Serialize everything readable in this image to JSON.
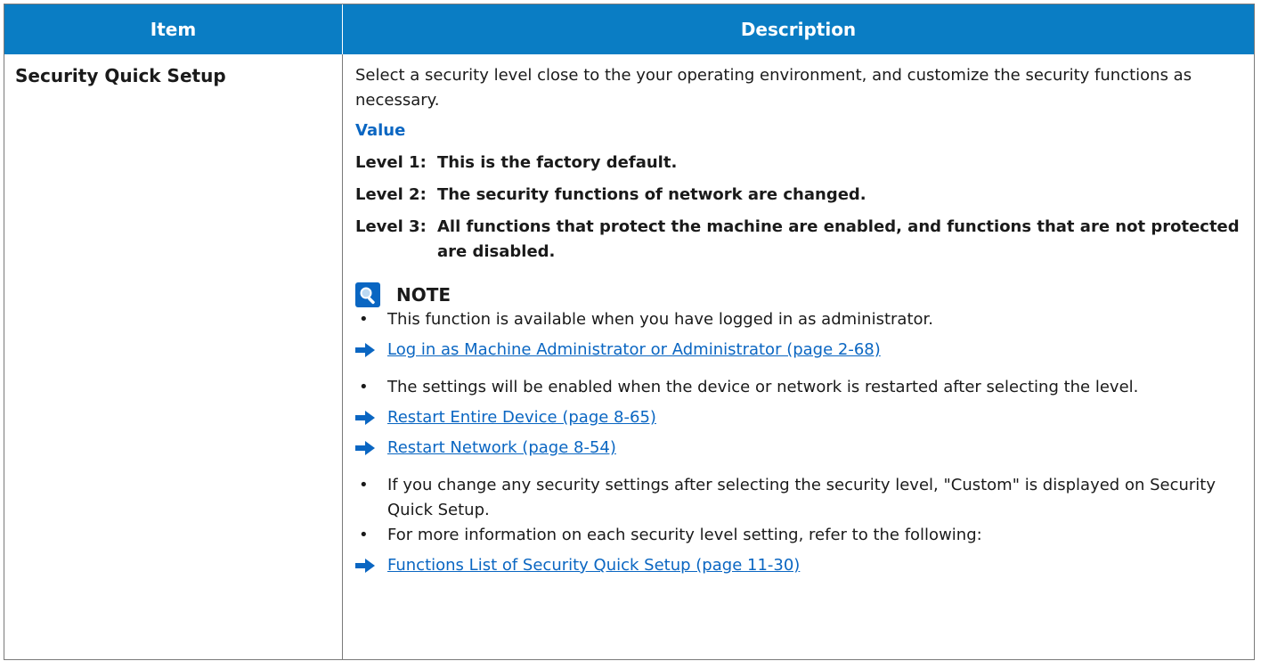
{
  "table": {
    "headers": [
      "Item",
      "Description"
    ],
    "item": "Security Quick Setup",
    "intro": "Select a security level close to the your operating environment, and customize the security functions as necessary.",
    "value_label": "Value",
    "levels": [
      {
        "key": "Level 1:",
        "text": "This is the factory default."
      },
      {
        "key": "Level 2:",
        "text": "The security functions of network are changed."
      },
      {
        "key": "Level 3:",
        "text": "All functions that protect the machine are enabled, and functions that are not protected are disabled."
      }
    ],
    "note_title": "NOTE",
    "bullets": [
      "This function is available when you have logged in as administrator.",
      "The settings will be enabled when the device or network is restarted after selecting the level.",
      "If you change any security settings after selecting the security level, \"Custom\" is displayed on Security Quick Setup.",
      "For more information on each security level setting, refer to the following:"
    ],
    "links": [
      "Log in as Machine Administrator or Administrator (page 2-68)",
      "Restart Entire Device (page 8-65)",
      "Restart Network (page 8-54)",
      "Functions List of Security Quick Setup (page 11-30)"
    ]
  },
  "colors": {
    "header_bg": "#0a7dc4",
    "link": "#0a66c2",
    "arrow": "#0a66c2"
  },
  "icons": [
    "note-icon",
    "arrow-right-icon"
  ]
}
